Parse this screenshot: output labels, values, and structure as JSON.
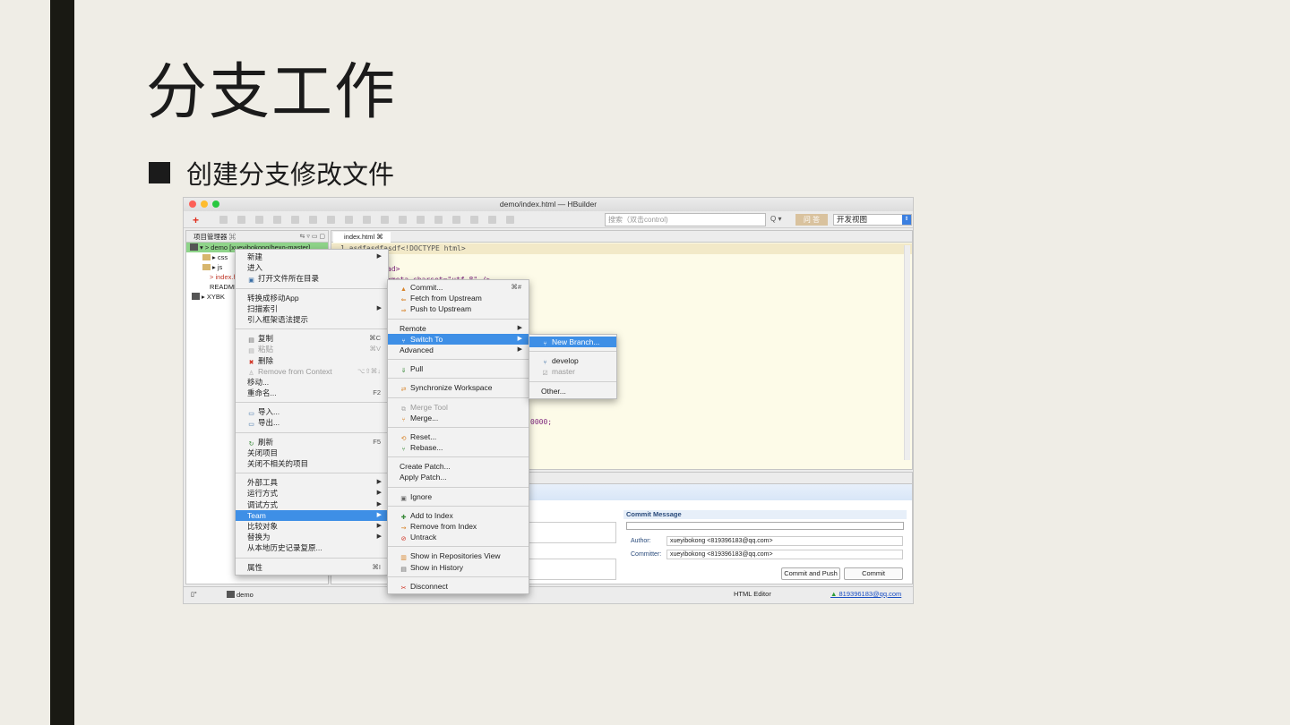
{
  "slide": {
    "title": "分支工作",
    "bullet": "创建分支修改文件"
  },
  "window": {
    "title": "demo/index.html — HBuilder",
    "search_placeholder": "搜索（双击control)",
    "qa_button": "问 答",
    "view_select": "开发视图"
  },
  "project_panel": {
    "tab": "项目管理器 ⌘",
    "tree": [
      "▾ > demo [xueyibokong/hexo-master]",
      "▸ css",
      "▸ js",
      "> index.html",
      "README.md",
      "▸ XYBK"
    ]
  },
  "editor": {
    "tab": "index.html ⌘",
    "lines": [
      "1  asdfasdfasdf<!DOCTYPE html>",
      "ad>",
      "<meta charset=\"utf-8\" />",
      "0000;"
    ]
  },
  "commit_panel": {
    "title": "Commit Message",
    "author_label": "Author:",
    "author_value": "xueyibokong <819396183@qq.com>",
    "committer_label": "Committer:",
    "committer_value": "xueyibokong <819396183@qq.com>",
    "commit_push_button": "Commit and Push",
    "commit_button": "Commit"
  },
  "statusbar": {
    "project": "demo",
    "editor_type": "HTML Editor",
    "user": "819396183@qq.com"
  },
  "context_menu": {
    "items": [
      {
        "label": "新建",
        "arrow": "▶"
      },
      {
        "label": "进入"
      },
      {
        "label": "打开文件所在目录"
      },
      {
        "sep": true
      },
      {
        "label": "转换成移动App"
      },
      {
        "label": "扫描索引",
        "arrow": "▶"
      },
      {
        "label": "引入框架语法提示"
      },
      {
        "sep": true
      },
      {
        "label": "复制",
        "shortcut": "⌘C"
      },
      {
        "label": "粘贴",
        "shortcut": "⌘V",
        "disabled": true
      },
      {
        "label": "删除"
      },
      {
        "label": "Remove from Context",
        "shortcut": "⌥⇧⌘↓",
        "disabled": true
      },
      {
        "label": "移动..."
      },
      {
        "label": "重命名...",
        "shortcut": "F2"
      },
      {
        "sep": true
      },
      {
        "label": "导入..."
      },
      {
        "label": "导出..."
      },
      {
        "sep": true
      },
      {
        "label": "刷新",
        "shortcut": "F5"
      },
      {
        "label": "关闭项目"
      },
      {
        "label": "关闭不相关的项目"
      },
      {
        "sep": true
      },
      {
        "label": "外部工具",
        "arrow": "▶"
      },
      {
        "label": "运行方式",
        "arrow": "▶"
      },
      {
        "label": "调试方式",
        "arrow": "▶"
      },
      {
        "label": "Team",
        "arrow": "▶",
        "highlight": true
      },
      {
        "label": "比较对象",
        "arrow": "▶"
      },
      {
        "label": "替换为",
        "arrow": "▶"
      },
      {
        "label": "从本地历史记录复原..."
      },
      {
        "sep": true
      },
      {
        "label": "属性",
        "shortcut": "⌘I"
      }
    ]
  },
  "team_menu": {
    "items": [
      {
        "label": "Commit...",
        "shortcut": "⌘#"
      },
      {
        "label": "Fetch from Upstream"
      },
      {
        "label": "Push to Upstream"
      },
      {
        "sep": true
      },
      {
        "label": "Remote",
        "arrow": "▶"
      },
      {
        "label": "Switch To",
        "arrow": "▶",
        "highlight": true
      },
      {
        "label": "Advanced",
        "arrow": "▶"
      },
      {
        "sep": true
      },
      {
        "label": "Pull"
      },
      {
        "sep": true
      },
      {
        "label": "Synchronize Workspace"
      },
      {
        "sep": true
      },
      {
        "label": "Merge Tool",
        "disabled": true
      },
      {
        "label": "Merge..."
      },
      {
        "sep": true
      },
      {
        "label": "Reset..."
      },
      {
        "label": "Rebase..."
      },
      {
        "sep": true
      },
      {
        "label": "Create Patch..."
      },
      {
        "label": "Apply Patch..."
      },
      {
        "sep": true
      },
      {
        "label": "Ignore"
      },
      {
        "sep": true
      },
      {
        "label": "Add to Index"
      },
      {
        "label": "Remove from Index"
      },
      {
        "label": "Untrack"
      },
      {
        "sep": true
      },
      {
        "label": "Show in Repositories View"
      },
      {
        "label": "Show in History"
      },
      {
        "sep": true
      },
      {
        "label": "Disconnect"
      }
    ]
  },
  "switch_menu": {
    "items": [
      {
        "label": "New Branch...",
        "highlight": true
      },
      {
        "sep": true
      },
      {
        "label": "develop"
      },
      {
        "label": "master",
        "disabled": true
      },
      {
        "sep": true
      },
      {
        "label": "Other..."
      }
    ]
  },
  "colors": {
    "highlight": "#3e8fe6",
    "accent_bar": "#191913",
    "background": "#efede6"
  }
}
